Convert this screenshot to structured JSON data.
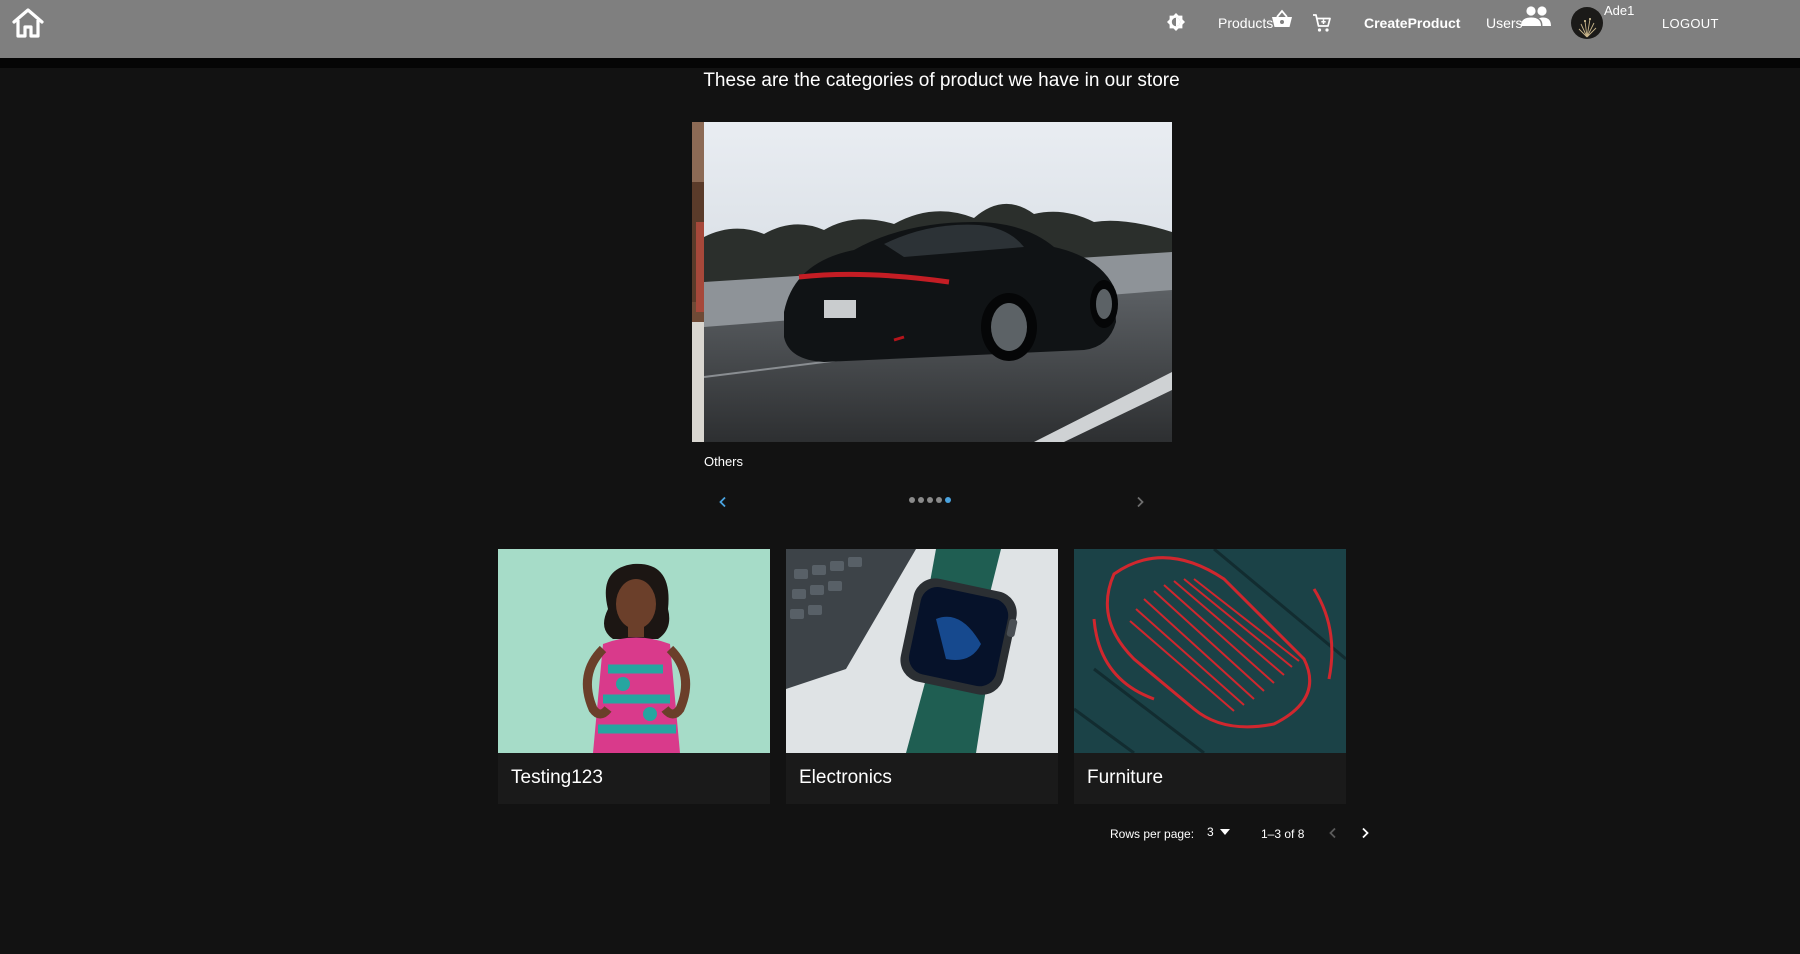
{
  "nav": {
    "products_label": "Products",
    "create_product_label": "CreateProduct",
    "users_label": "Users",
    "user_name": "Ade1",
    "logout_label": "LOGOUT"
  },
  "heading": "These are the categories of product we have in our store",
  "carousel": {
    "caption": "Others",
    "dot_count": 5,
    "active_index": 4,
    "accent_color": "#4aa3df"
  },
  "categories": [
    {
      "title": "Testing123"
    },
    {
      "title": "Electronics"
    },
    {
      "title": "Furniture"
    }
  ],
  "pagination": {
    "rows_label": "Rows per page:",
    "rows_value": "3",
    "range_label": "1–3 of 8"
  },
  "icons": [
    "home-icon",
    "brightness-icon",
    "basket-icon",
    "cart-icon",
    "people-icon",
    "chevron-left-icon",
    "chevron-right-icon",
    "caret-down-icon"
  ]
}
